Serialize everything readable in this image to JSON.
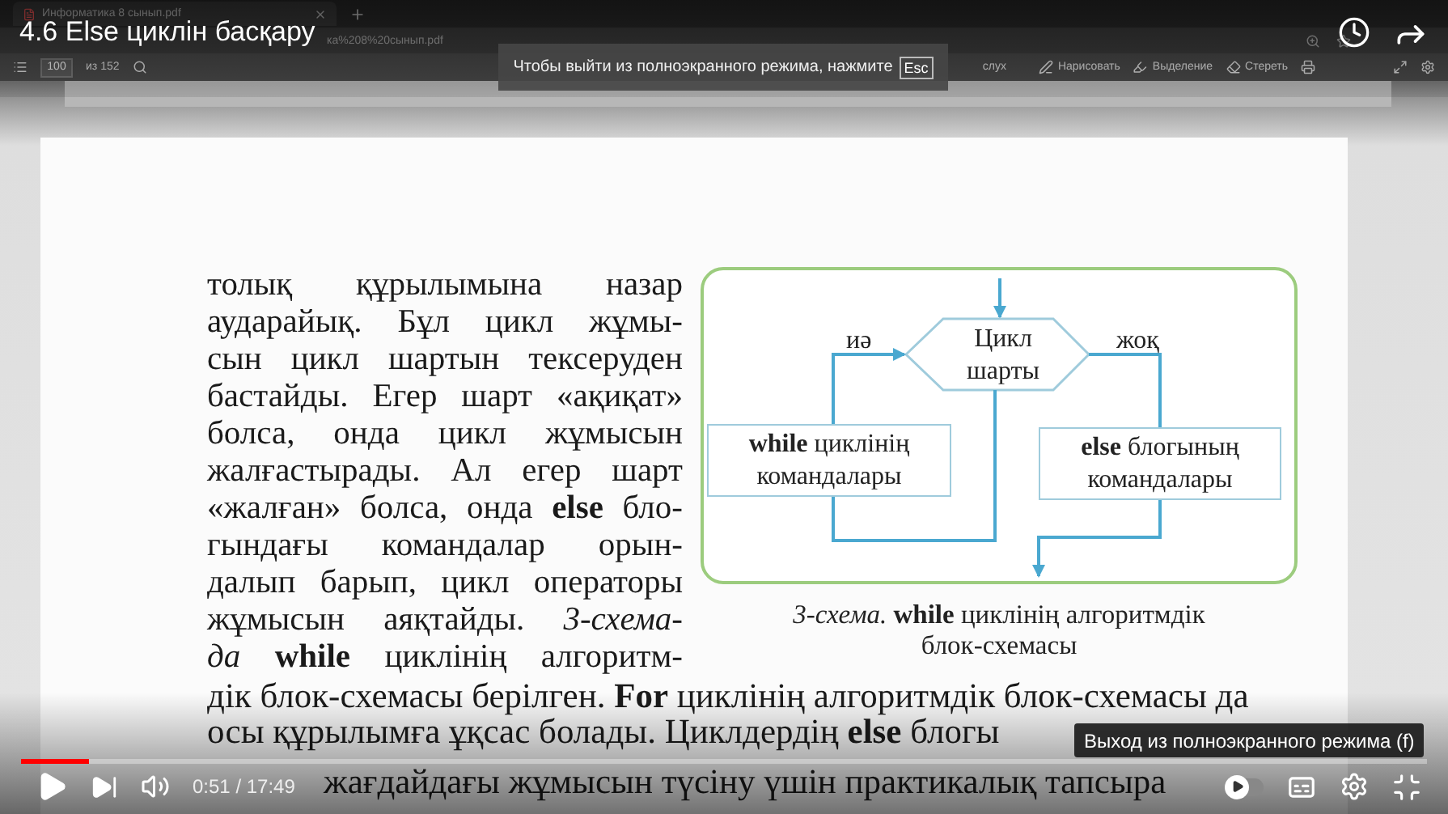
{
  "video": {
    "title": "4.6 Else циклін басқару",
    "time": "0:51 / 17:49",
    "progress": {
      "level": 0.048
    },
    "autoplay": {
      "on": false
    },
    "tooltip": "Выход из полноэкранного режима (f)"
  },
  "browser": {
    "tab": "Информатика 8 сынып.pdf",
    "address": "ка%208%20сынып.pdf"
  },
  "pdf_toolbar": {
    "page": "100",
    "page_count": "из 152",
    "tools": [
      {
        "kind": "read",
        "label": "слух"
      },
      {
        "kind": "draw",
        "label": "Нарисовать"
      },
      {
        "kind": "highlight",
        "label": "Выделение"
      },
      {
        "kind": "erase",
        "label": "Стереть"
      }
    ]
  },
  "notice": {
    "text": "Чтобы выйти из полноэкранного режима, нажмите",
    "key": "Esc"
  },
  "book": {
    "lines": [
      "толық құрылымына назар",
      "аударайық. Бұл цикл жұмы-",
      "сын цикл шартын тексеруден",
      "бастайды. Егер шарт «ақиқат»",
      "болса, онда цикл жұмысын",
      "жалғастырады. Ал егер шарт",
      "«жалған» болса, онда **else** бло-",
      "гындағы командалар орын-",
      "далып барып, цикл операторы",
      "жұмысын аяқтайды. *3-схема-*",
      "*да* **while** циклінің алгоритм-"
    ],
    "flowchart": {
      "condition": [
        "Цикл",
        "шарты"
      ],
      "yes": "иә",
      "no": "жоқ",
      "loop_box": "**while** циклінің командалары",
      "else_box": "**else** блогының командалары"
    },
    "caption": "*3-схема.* **while** циклінің алгоритмдік блок-схемасы",
    "full_lines": [
      "дік блок-схемасы берілген. **For** циклінің алгоритмдік блок-схемасы да",
      "осы құрылымға ұқсас болады. Циклдердің **else** блогы",
      "жағдайдағы жұмысын түсіну үшін практикалық тапсыра"
    ]
  }
}
